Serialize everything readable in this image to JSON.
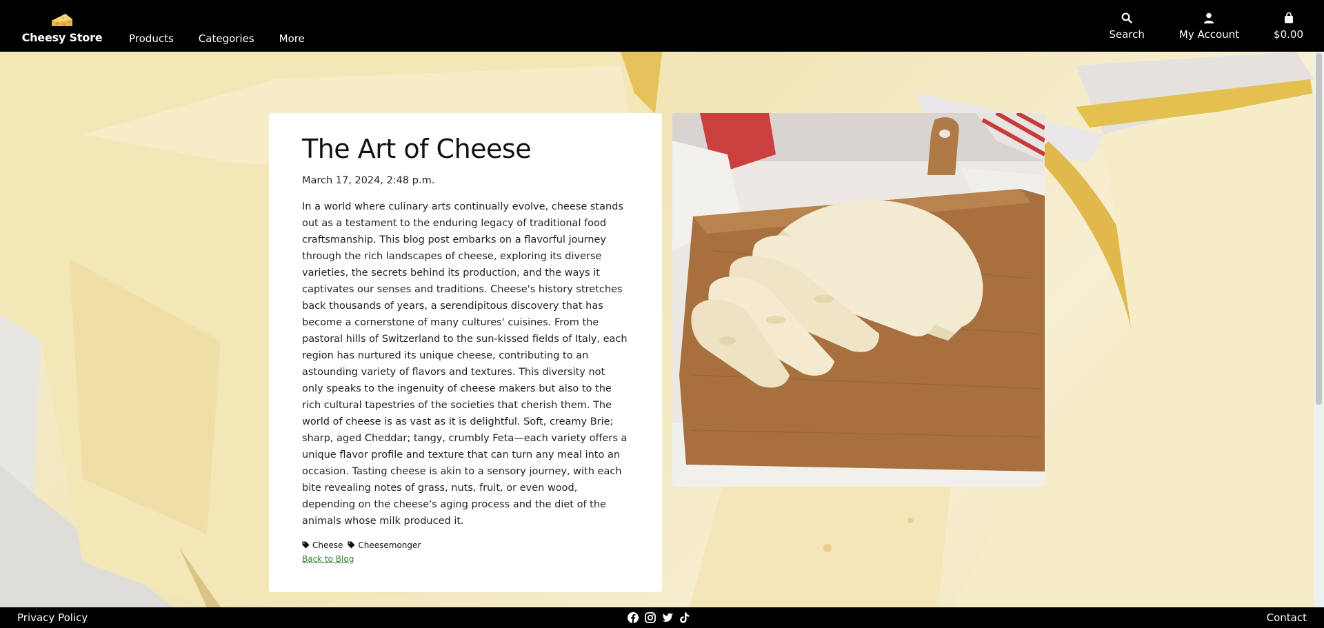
{
  "header": {
    "brand": "Cheesy Store",
    "nav": [
      "Products",
      "Categories",
      "More"
    ],
    "search_label": "Search",
    "account_label": "My Account",
    "cart_total": "$0.00"
  },
  "article": {
    "title": "The Art of Cheese",
    "date": "March 17, 2024, 2:48 p.m.",
    "body": "In a world where culinary arts continually evolve, cheese stands out as a testament to the enduring legacy of traditional food craftsmanship. This blog post embarks on a flavorful journey through the rich landscapes of cheese, exploring its diverse varieties, the secrets behind its production, and the ways it captivates our senses and traditions. Cheese's history stretches back thousands of years, a serendipitous discovery that has become a cornerstone of many cultures' cuisines. From the pastoral hills of Switzerland to the sun-kissed fields of Italy, each region has nurtured its unique cheese, contributing to an astounding variety of flavors and textures. This diversity not only speaks to the ingenuity of cheese makers but also to the rich cultural tapestries of the societies that cherish them. The world of cheese is as vast as it is delightful. Soft, creamy Brie; sharp, aged Cheddar; tangy, crumbly Feta—each variety offers a unique flavor profile and texture that can turn any meal into an occasion. Tasting cheese is akin to a sensory journey, with each bite revealing notes of grass, nuts, fruit, or even wood, depending on the cheese's aging process and the diet of the animals whose milk produced it.",
    "tags": [
      "Cheese",
      "Cheesemonger"
    ],
    "back_link": "Back to Blog"
  },
  "footer": {
    "privacy": "Privacy Policy",
    "contact": "Contact",
    "social_icons": [
      "facebook-icon",
      "instagram-icon",
      "twitter-icon",
      "tiktok-icon"
    ]
  },
  "colors": {
    "header_bg": "#000000",
    "link_green": "#2f7d32",
    "card_bg": "#ffffff"
  }
}
